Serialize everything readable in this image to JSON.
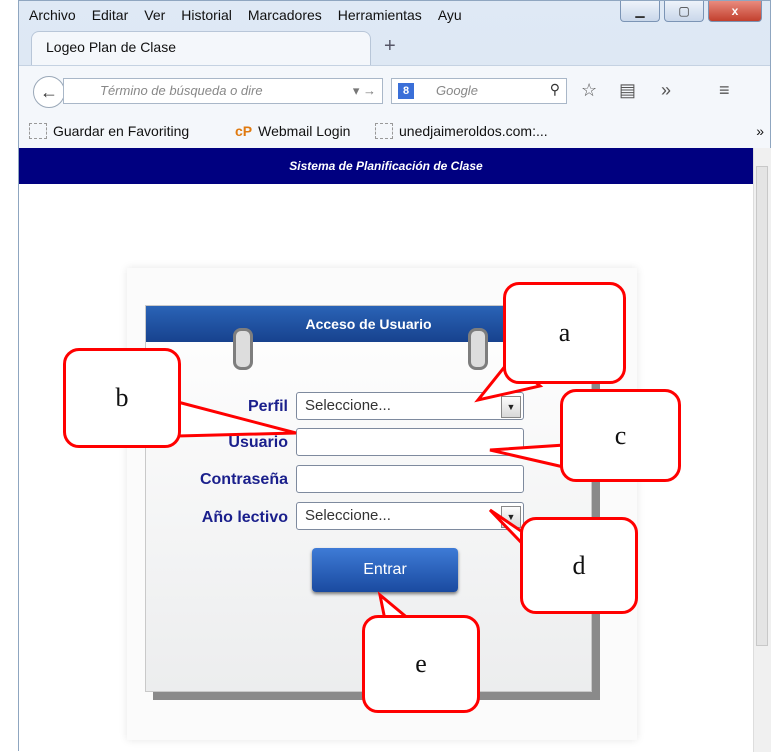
{
  "menu": [
    "Archivo",
    "Editar",
    "Ver",
    "Historial",
    "Marcadores",
    "Herramientas",
    "Ayu"
  ],
  "window_controls": {
    "minimize_icon": "minimize-icon",
    "maximize_icon": "maximize-icon",
    "close_label": "x"
  },
  "tab": {
    "title": "Logeo Plan de Clase",
    "new_tab": "+"
  },
  "navbar": {
    "url_placeholder": "Término de búsqueda o dire",
    "search_engine": "8",
    "search_placeholder": "Google",
    "back_icon": "back-arrow-icon",
    "star_icon": "☆",
    "clipboard_icon": "▤",
    "overflow_icon": "»",
    "menu_icon": "≡"
  },
  "bookmarks": [
    {
      "label": "Guardar en Favoriting"
    },
    {
      "label": "Webmail Login",
      "prefix": "cP"
    },
    {
      "label": "unedjaimeroldos.com:..."
    }
  ],
  "bookmarks_overflow": "»",
  "page": {
    "banner": "Sistema de Planificación de Clase",
    "card_title": "Acceso de Usuario",
    "form": {
      "perfil_label": "Perfil",
      "perfil_value": "Seleccione...",
      "usuario_label": "Usuario",
      "usuario_value": "",
      "contrasena_label": "Contraseña",
      "contrasena_value": "",
      "anio_label": "Año lectivo",
      "anio_value": "Seleccione..."
    },
    "submit_label": "Entrar"
  },
  "callouts": {
    "a": "a",
    "b": "b",
    "c": "c",
    "d": "d",
    "e": "e"
  },
  "colors": {
    "banner": "#000080",
    "label": "#1a1f8c",
    "callout": "#ff0000",
    "button": "#2a63b6"
  }
}
